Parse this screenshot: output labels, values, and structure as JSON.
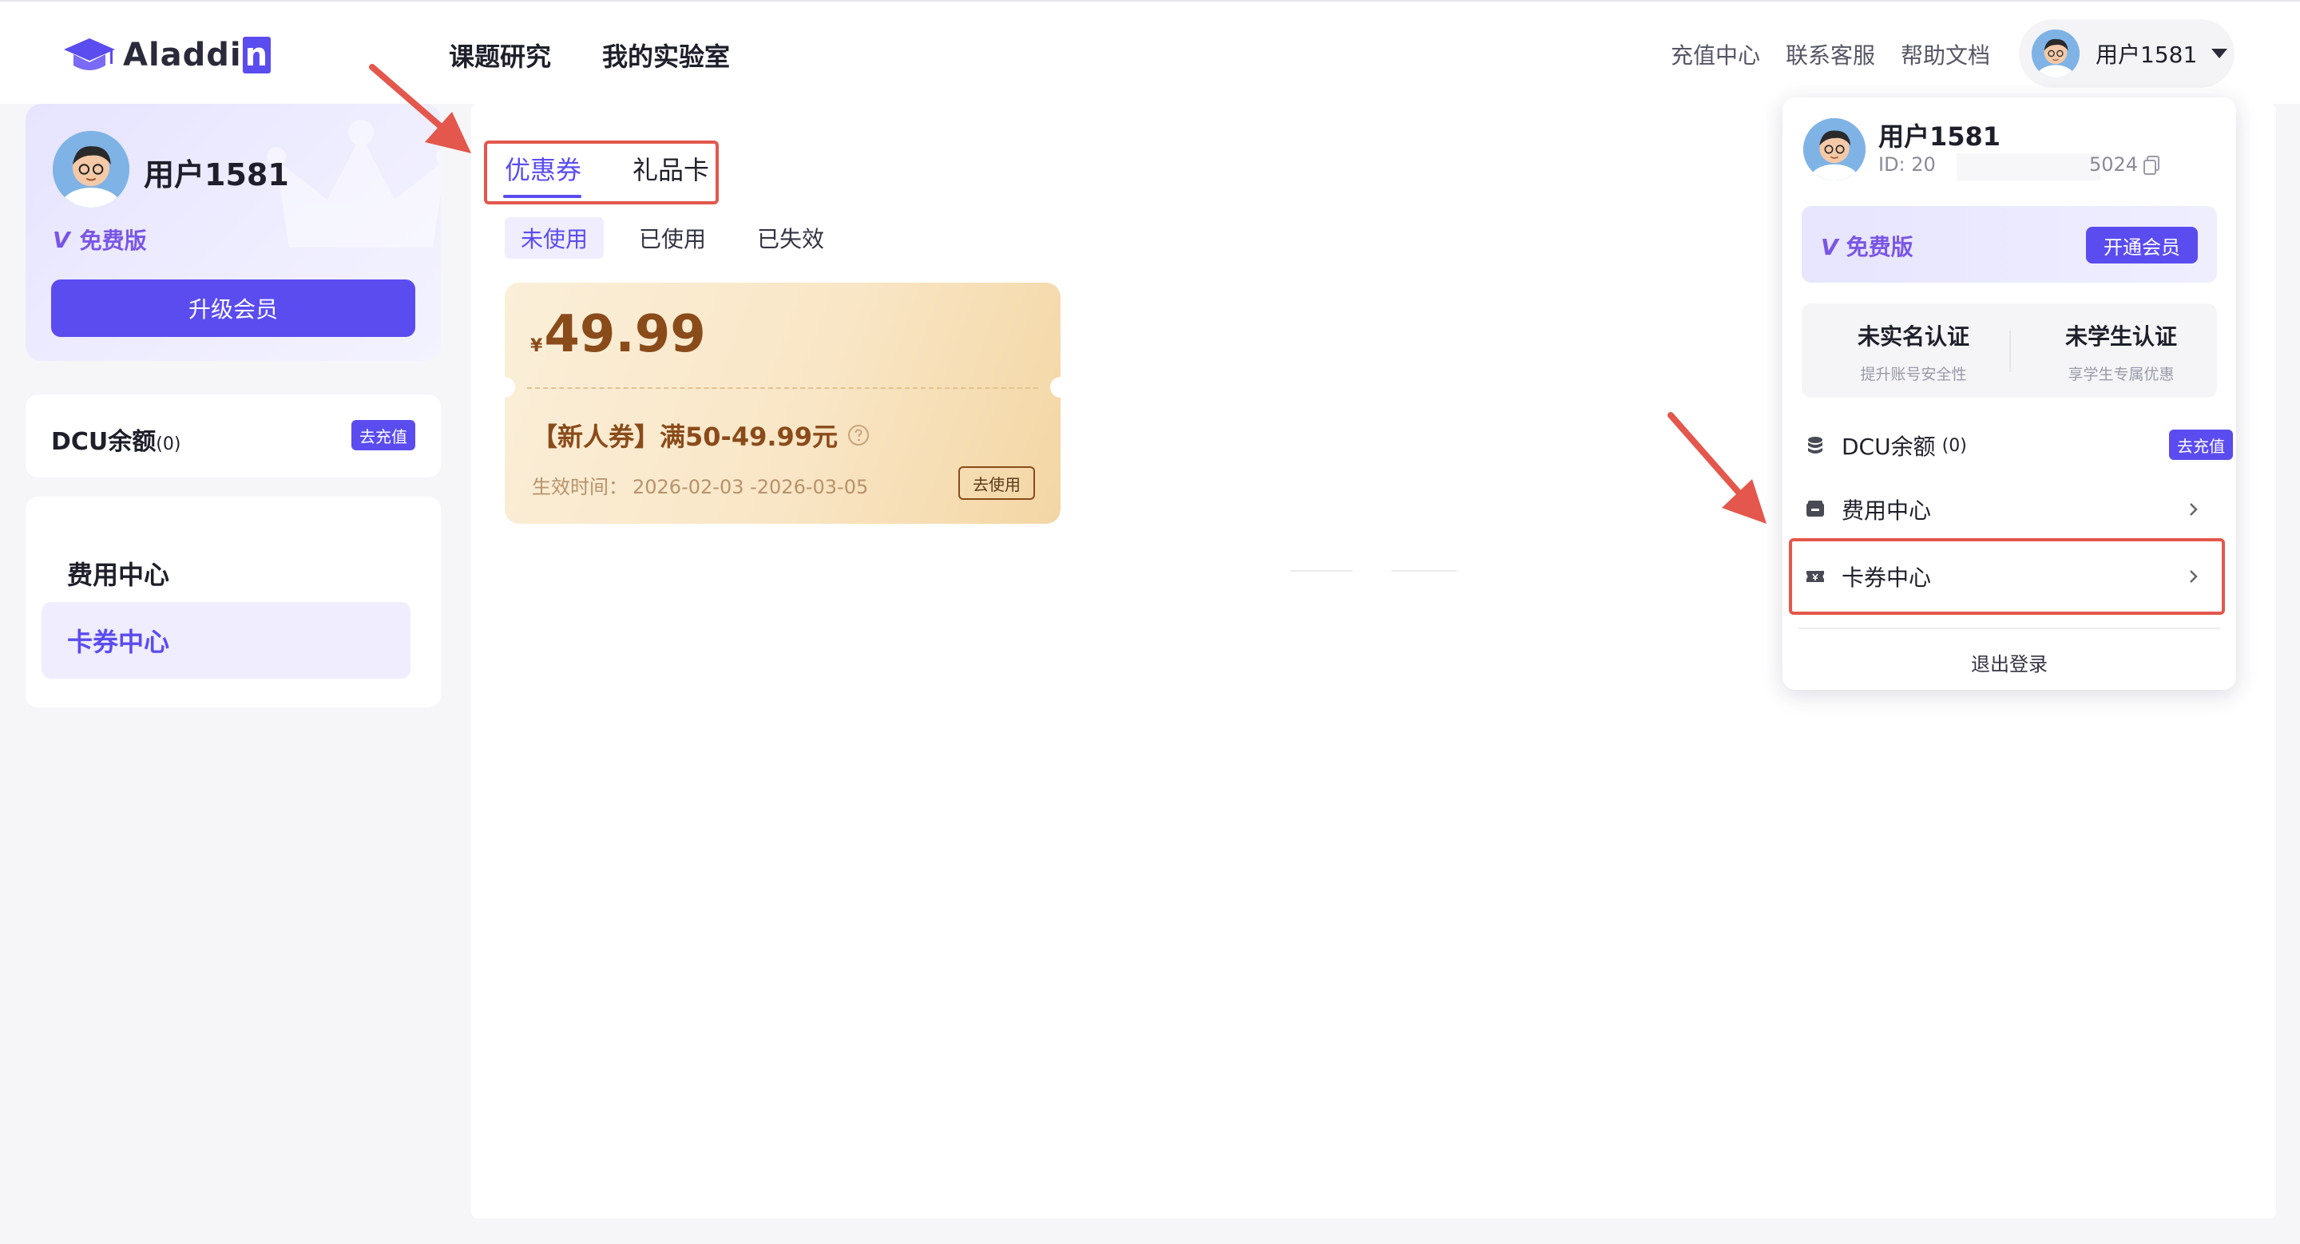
{
  "header": {
    "logo_text": "Aladdi",
    "logo_last_letter": "n",
    "nav": [
      "课题研究",
      "我的实验室"
    ],
    "links": [
      "充值中心",
      "联系客服",
      "帮助文档"
    ],
    "user_name": "用户1581"
  },
  "sidebar": {
    "member": {
      "name": "用户1581",
      "level": "免费版",
      "level_mark": "V",
      "upgrade_label": "升级会员"
    },
    "dcu": {
      "label": "DCU余额",
      "count": "(0)",
      "recharge_label": "去充值"
    },
    "menu": [
      {
        "label": "费用中心"
      },
      {
        "label": "卡券中心",
        "active": true
      }
    ]
  },
  "main": {
    "tabs": [
      {
        "label": "优惠券",
        "active": true
      },
      {
        "label": "礼品卡"
      }
    ],
    "subtabs": [
      {
        "label": "未使用",
        "active": true
      },
      {
        "label": "已使用"
      },
      {
        "label": "已失效"
      }
    ],
    "coupon": {
      "currency": "¥",
      "amount": "49.99",
      "title": "【新人券】满50-49.99元",
      "validity_label": "生效时间：",
      "validity": "2026-02-03 -2026-03-05",
      "use_label": "去使用"
    }
  },
  "dropdown": {
    "name": "用户1581",
    "id_prefix": "ID: 20",
    "id_suffix": "5024",
    "level": "免费版",
    "level_mark": "V",
    "open_label": "开通会员",
    "verify": [
      {
        "title": "未实名认证",
        "subtitle": "提升账号安全性"
      },
      {
        "title": "未学生认证",
        "subtitle": "享学生专属优惠"
      }
    ],
    "dcu": {
      "label": "DCU余额",
      "count": "(0)",
      "recharge_label": "去充值"
    },
    "items": [
      {
        "label": "费用中心"
      },
      {
        "label": "卡券中心"
      }
    ],
    "logout_label": "退出登录"
  },
  "colors": {
    "accent": "#5b4cf0",
    "level_purple": "#7a56e6",
    "coupon_brown": "#8a4b1a",
    "annotation_red": "#e3574c"
  },
  "icons": {
    "logo": "graduation-cap-icon",
    "help": "question-circle-icon",
    "copy": "copy-icon",
    "dcu": "coin-stack-icon",
    "billing": "wallet-icon",
    "coupon": "ticket-icon",
    "chevron": "chevron-right-icon",
    "caret": "caret-down-icon"
  }
}
